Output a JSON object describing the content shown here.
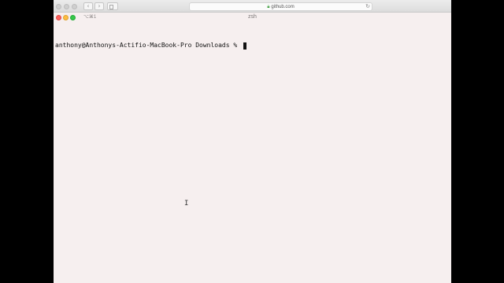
{
  "browser": {
    "url": "github.com",
    "back_icon": "chevron-left-icon",
    "forward_icon": "chevron-right-icon",
    "sidebar_icon": "sidebar-icon",
    "lock_icon": "lock-icon",
    "reload_icon": "reload-icon"
  },
  "terminal": {
    "title": "zsh",
    "tab_shortcut": "⌥⌘1",
    "prompt": "anthony@Anthonys-Actifio-MacBook-Pro Downloads % ",
    "colors": {
      "background": "#f6efef",
      "text": "#111111",
      "close": "#fc605c",
      "minimize": "#fdbc40",
      "maximize": "#34c84a"
    }
  }
}
